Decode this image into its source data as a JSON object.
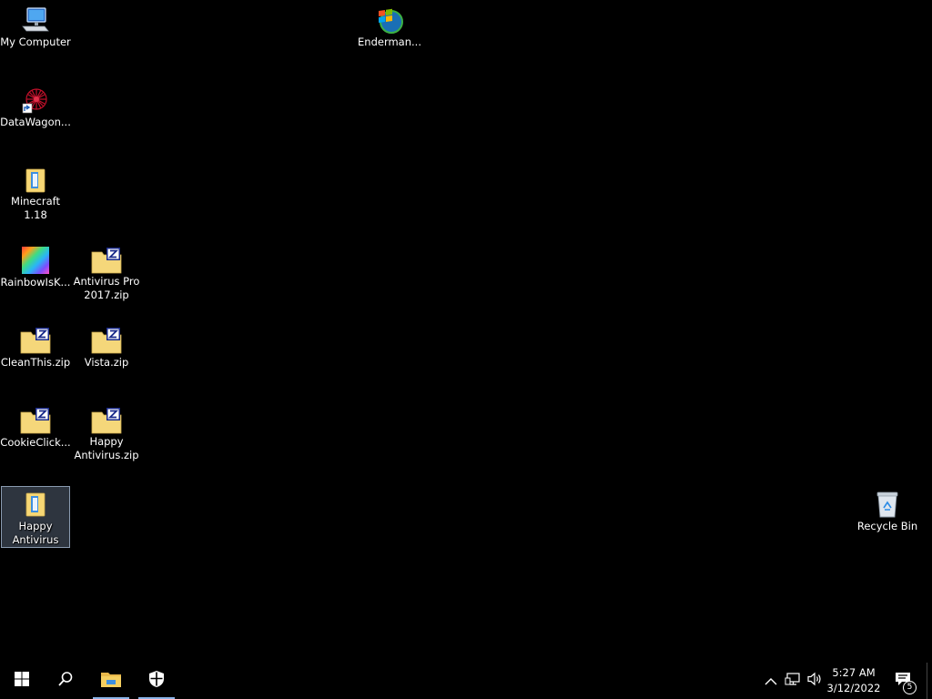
{
  "desktop": {
    "background_color": "#000000",
    "icons": [
      {
        "id": "my-computer",
        "label": "My Computer",
        "icon": "computer-icon",
        "selected": false
      },
      {
        "id": "enderman",
        "label": "Enderman...",
        "icon": "windows-orb-icon",
        "selected": false
      },
      {
        "id": "datawagon",
        "label": "DataWagon...",
        "icon": "shortcut-app-icon",
        "selected": false
      },
      {
        "id": "minecraft",
        "label": "Minecraft 1.18",
        "icon": "folder-icon",
        "selected": false
      },
      {
        "id": "rainbowisk",
        "label": "RainbowIsK...",
        "icon": "rainbow-image-icon",
        "selected": false
      },
      {
        "id": "antivirus-pro",
        "label": "Antivirus Pro 2017.zip",
        "icon": "zip-folder-icon",
        "selected": false
      },
      {
        "id": "cleanthis",
        "label": "CleanThis.zip",
        "icon": "zip-folder-icon",
        "selected": false
      },
      {
        "id": "vista",
        "label": "Vista.zip",
        "icon": "zip-folder-icon",
        "selected": false
      },
      {
        "id": "cookieclick",
        "label": "CookieClick...",
        "icon": "zip-folder-icon",
        "selected": false
      },
      {
        "id": "happy-antivirus-zip",
        "label": "Happy Antivirus.zip",
        "icon": "zip-folder-icon",
        "selected": false
      },
      {
        "id": "happy-antivirus",
        "label": "Happy Antivirus",
        "icon": "folder-icon",
        "selected": true
      },
      {
        "id": "recycle-bin",
        "label": "Recycle Bin",
        "icon": "recycle-bin-icon",
        "selected": false
      }
    ]
  },
  "taskbar": {
    "background_color": "#000000",
    "buttons": [
      {
        "id": "start",
        "icon": "windows-start-icon"
      },
      {
        "id": "search",
        "icon": "search-icon"
      },
      {
        "id": "file-explorer",
        "icon": "file-explorer-icon",
        "running": true
      },
      {
        "id": "windows-security",
        "icon": "shield-icon",
        "running": true
      }
    ],
    "tray": {
      "icons": [
        "chevron-up-icon",
        "network-icon",
        "volume-icon"
      ],
      "time": "5:27 AM",
      "date": "3/12/2022",
      "notification_count": "5"
    }
  }
}
